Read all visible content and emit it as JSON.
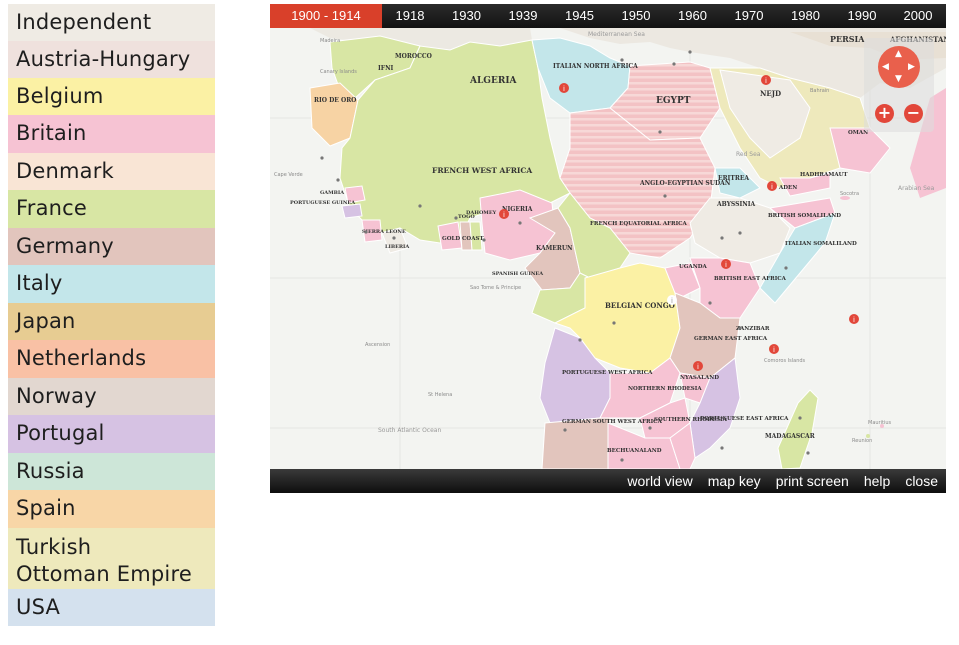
{
  "legend": [
    {
      "label": "Independent",
      "color": "#efebe4"
    },
    {
      "label": "Austria-Hungary",
      "color": "#efe1dd"
    },
    {
      "label": "Belgium",
      "color": "#fbf1a4"
    },
    {
      "label": "Britain",
      "color": "#f6c3d3"
    },
    {
      "label": "Denmark",
      "color": "#f9e5d5"
    },
    {
      "label": "France",
      "color": "#d8e6a4"
    },
    {
      "label": "Germany",
      "color": "#e2c5bd"
    },
    {
      "label": "Italy",
      "color": "#c3e6ea"
    },
    {
      "label": "Japan",
      "color": "#e7cc92"
    },
    {
      "label": "Netherlands",
      "color": "#f9c1a5"
    },
    {
      "label": "Norway",
      "color": "#e2d7d0"
    },
    {
      "label": "Portugal",
      "color": "#d6c2e3"
    },
    {
      "label": "Russia",
      "color": "#cde6d8"
    },
    {
      "label": "Spain",
      "color": "#f8d6a7"
    },
    {
      "label": "Turkish Ottoman Empire",
      "line1": "Turkish",
      "line2": "Ottoman Empire",
      "color": "#eee9bc"
    },
    {
      "label": "USA",
      "color": "#d4e1ee"
    }
  ],
  "timeline": {
    "periods": [
      "1900  -  1914",
      "1918",
      "1930",
      "1939",
      "1945",
      "1950",
      "1960",
      "1970",
      "1980",
      "1990",
      "2000"
    ],
    "active": "1900  -  1914"
  },
  "footer": {
    "world_view": "world view",
    "map_key": "map key",
    "print_screen": "print screen",
    "help": "help",
    "close": "close"
  },
  "zoom": {
    "in": "+",
    "out": "−"
  },
  "map": {
    "regions": {
      "algeria": "ALGERIA",
      "morocco": "MOROCCO",
      "ifni": "IFNI",
      "rio_de_oro": "RIO DE ORO",
      "french_west_africa": "FRENCH WEST AFRICA",
      "italian_north_africa": "ITALIAN NORTH AFRICA",
      "egypt": "EGYPT",
      "anglo_egyptian_sudan": "ANGLO-EGYPTIAN SUDAN",
      "eritrea": "ERITREA",
      "abyssinia": "ABYSSINIA",
      "british_somaliland": "BRITISH SOMALILAND",
      "italian_somaliland": "ITALIAN SOMALILAND",
      "aden": "ADEN",
      "hadhramaut": "HADHRAMAUT",
      "nejd": "NEJD",
      "oman": "OMAN",
      "persia": "PERSIA",
      "afghanistan": "AFGHANISTAN",
      "nigeria": "NIGERIA",
      "kamerun": "KAMERUN",
      "french_equatorial_africa": "FRENCH EQUATORIAL AFRICA",
      "belgian_congo": "BELGIAN CONGO",
      "uganda": "UGANDA",
      "british_east_africa": "BRITISH EAST AFRICA",
      "german_east_africa": "GERMAN EAST AFRICA",
      "zanzibar": "ZANZIBAR",
      "portuguese_west_africa": "PORTUGUESE WEST AFRICA",
      "northern_rhodesia": "NORTHERN RHODESIA",
      "nyasaland": "NYASALAND",
      "southern_rhodesia": "SOUTHERN RHODESIA",
      "portuguese_east_africa": "PORTUGUESE EAST AFRICA",
      "german_south_west_africa": "GERMAN SOUTH WEST AFRICA",
      "bechuanaland": "BECHUANALAND",
      "madagascar": "MADAGASCAR",
      "gold_coast": "GOLD COAST",
      "liberia": "LIBERIA",
      "sierra_leone": "SIERRA LEONE",
      "portuguese_guinea": "PORTUGUESE GUINEA",
      "gambia": "GAMBIA",
      "togo": "TOGO",
      "dahomey": "DAHOMEY",
      "spanish_guinea": "SPANISH GUINEA",
      "comoros": "Comoros Islands",
      "mauritius": "Mauritius",
      "reunion": "Reunion",
      "socotra": "Socotra",
      "madeira": "Madeira",
      "canary_islands": "Canary Islands",
      "cape_verde": "Cape Verde",
      "sao_tome": "Sao Tome & Principe",
      "ascension": "Ascension",
      "st_helena": "St Helena",
      "bahrain": "Bahrain"
    },
    "seas": {
      "south_atlantic": "South Atlantic Ocean",
      "mediterranean": "Mediterranean Sea",
      "red_sea": "Red Sea",
      "arabian_sea": "Arabian Sea"
    }
  }
}
